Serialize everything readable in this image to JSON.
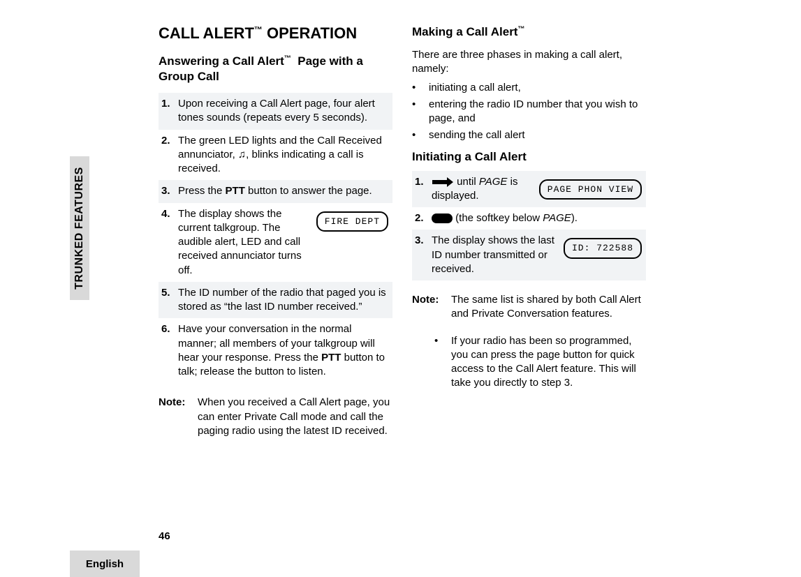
{
  "sidebar": {
    "label": "TRUNKED FEATURES"
  },
  "footer": {
    "page": "46",
    "language": "English"
  },
  "left": {
    "h1": "CALL ALERT",
    "h1_suffix": "OPERATION",
    "h2": "Answering a Call Alert",
    "h2_suffix": "Page with a Group Call",
    "steps": [
      {
        "n": "1.",
        "text": "Upon receiving a Call Alert page, four alert tones sounds (repeats every 5 seconds)."
      },
      {
        "n": "2.",
        "pre": "The green LED lights and the Call Received annunciator, ",
        "note": "♫",
        "post": ", blinks indicating a call is received."
      },
      {
        "n": "3.",
        "pre": "Press the ",
        "bold": "PTT",
        "post": " button to answer the page."
      },
      {
        "n": "4.",
        "text": "The display shows the current talkgroup. The audible alert, LED and call received annunciator turns off.",
        "lcd": "FIRE DEPT"
      },
      {
        "n": "5.",
        "text": "The ID number of the radio that paged you is stored as “the last ID number received.”"
      },
      {
        "n": "6.",
        "pre": "Have your conversation in the normal manner; all members of your talkgroup will hear your response. Press the ",
        "bold": "PTT",
        "post": " button to talk; release the button to listen."
      }
    ],
    "note_label": "Note:",
    "note_text": "When you received a Call Alert page, you can enter Private Call mode and call the paging radio using the latest ID received."
  },
  "right": {
    "h2": "Making a Call Alert",
    "intro": "There are three phases in making a call alert, namely:",
    "bullets": [
      "initiating a call alert,",
      "entering the radio ID number that you wish to page, and",
      "sending the call alert"
    ],
    "h3": "Initiating a Call Alert",
    "steps": [
      {
        "n": "1.",
        "pre": " until ",
        "ital": "PAGE",
        "post": " is displayed.",
        "lcd": "PAGE PHON  VIEW",
        "icon": "arrow"
      },
      {
        "n": "2.",
        "pre": " (the softkey below ",
        "ital": "PAGE",
        "post": ").",
        "icon": "soft"
      },
      {
        "n": "3.",
        "text": "The display shows the last ID number transmitted or received.",
        "lcd": "ID: 722588"
      }
    ],
    "note_label": "Note:",
    "note_text": "The same list is shared by both Call Alert and Private Conversation features.",
    "sub_bullet": "If your radio has been so programmed, you can press the page button for quick access to the Call Alert feature. This will take you directly to step 3."
  }
}
